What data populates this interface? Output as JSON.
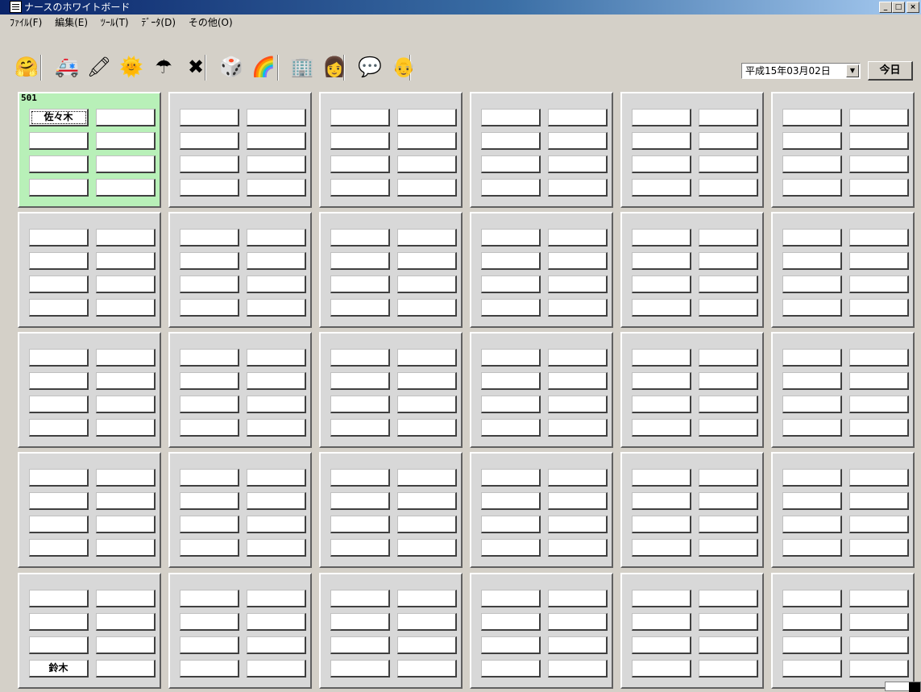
{
  "window": {
    "title": "ナースのホワイトボード",
    "buttons": {
      "minimize": "_",
      "maximize": "□",
      "close": "×"
    }
  },
  "menu": {
    "items": [
      "ﾌｧｲﾙ(F)",
      "編集(E)",
      "ﾂｰﾙ(T)",
      "ﾃﾞｰﾀ(D)",
      "その他(O)"
    ]
  },
  "toolbar": {
    "icons": [
      {
        "name": "mata-ne-icon",
        "glyph": "🤗"
      },
      {
        "name": "ambulance-icon",
        "glyph": "🚑"
      },
      {
        "name": "green-pencil-icon",
        "glyph": "🖍"
      },
      {
        "name": "red-sun-icon",
        "glyph": "🌞"
      },
      {
        "name": "umbrella-icon",
        "glyph": "☂"
      },
      {
        "name": "red-x-icon",
        "glyph": "✖"
      },
      {
        "name": "dice-icon",
        "glyph": "🎲"
      },
      {
        "name": "rainbow-icon",
        "glyph": "🌈"
      },
      {
        "name": "building-icon",
        "glyph": "🏢"
      },
      {
        "name": "nurse-icon",
        "glyph": "👩"
      },
      {
        "name": "speech-bubble-icon",
        "glyph": "💬"
      },
      {
        "name": "doctor-icon",
        "glyph": "👴"
      }
    ],
    "date_value": "平成15年03月02日",
    "today_label": "今日"
  },
  "rooms": {
    "first_room_label": "501",
    "names": {
      "r0c0s0": "佐々木",
      "r4c0s6": "鈴木"
    }
  }
}
